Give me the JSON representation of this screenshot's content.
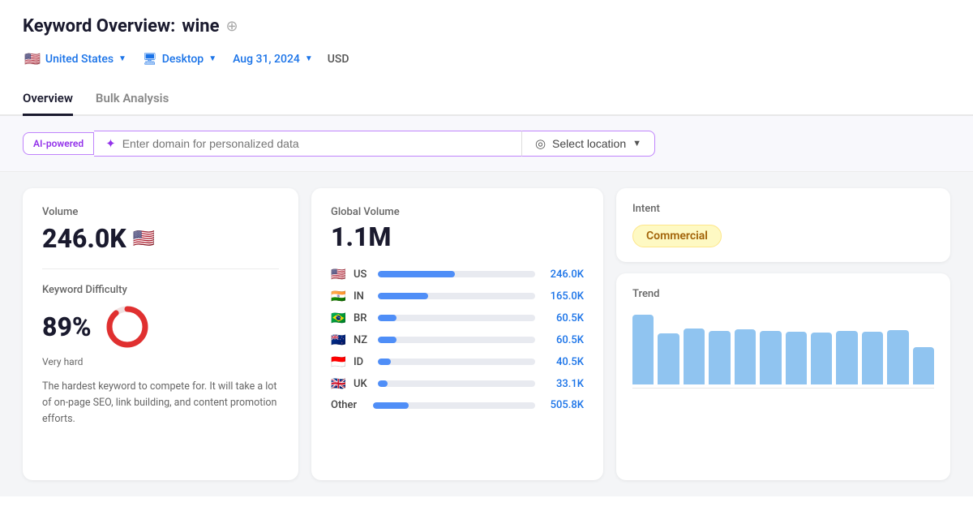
{
  "header": {
    "title": "Keyword Overview:",
    "keyword": "wine",
    "add_icon": "⊕",
    "location": "United States",
    "location_flag": "🇺🇸",
    "device": "Desktop",
    "date": "Aug 31, 2024",
    "currency": "USD"
  },
  "tabs": [
    {
      "label": "Overview",
      "active": true
    },
    {
      "label": "Bulk Analysis",
      "active": false
    }
  ],
  "ai_bar": {
    "badge": "AI-powered",
    "input_placeholder": "Enter domain for personalized data",
    "location_label": "Select location"
  },
  "volume_card": {
    "label": "Volume",
    "value": "246.0K",
    "flag": "🇺🇸",
    "difficulty_label": "Keyword Difficulty",
    "difficulty_value": "89%",
    "difficulty_text": "Very hard",
    "difficulty_desc": "The hardest keyword to compete for. It will take a lot of on-page SEO, link building, and content promotion efforts.",
    "donut_pct": 89
  },
  "global_card": {
    "label": "Global Volume",
    "value": "1.1M",
    "countries": [
      {
        "flag": "🇺🇸",
        "code": "US",
        "bar_pct": 49,
        "value": "246.0K"
      },
      {
        "flag": "🇮🇳",
        "code": "IN",
        "bar_pct": 32,
        "value": "165.0K"
      },
      {
        "flag": "🇧🇷",
        "code": "BR",
        "bar_pct": 12,
        "value": "60.5K"
      },
      {
        "flag": "🇳🇿",
        "code": "NZ",
        "bar_pct": 12,
        "value": "60.5K"
      },
      {
        "flag": "🇮🇩",
        "code": "ID",
        "bar_pct": 8,
        "value": "40.5K"
      },
      {
        "flag": "🇬🇧",
        "code": "UK",
        "bar_pct": 6,
        "value": "33.1K"
      }
    ],
    "other_label": "Other",
    "other_bar_pct": 22,
    "other_value": "505.8K"
  },
  "intent_card": {
    "label": "Intent",
    "badge": "Commercial"
  },
  "trend_card": {
    "label": "Trend",
    "bars": [
      85,
      62,
      68,
      65,
      67,
      65,
      64,
      63,
      65,
      64,
      66,
      45
    ]
  }
}
